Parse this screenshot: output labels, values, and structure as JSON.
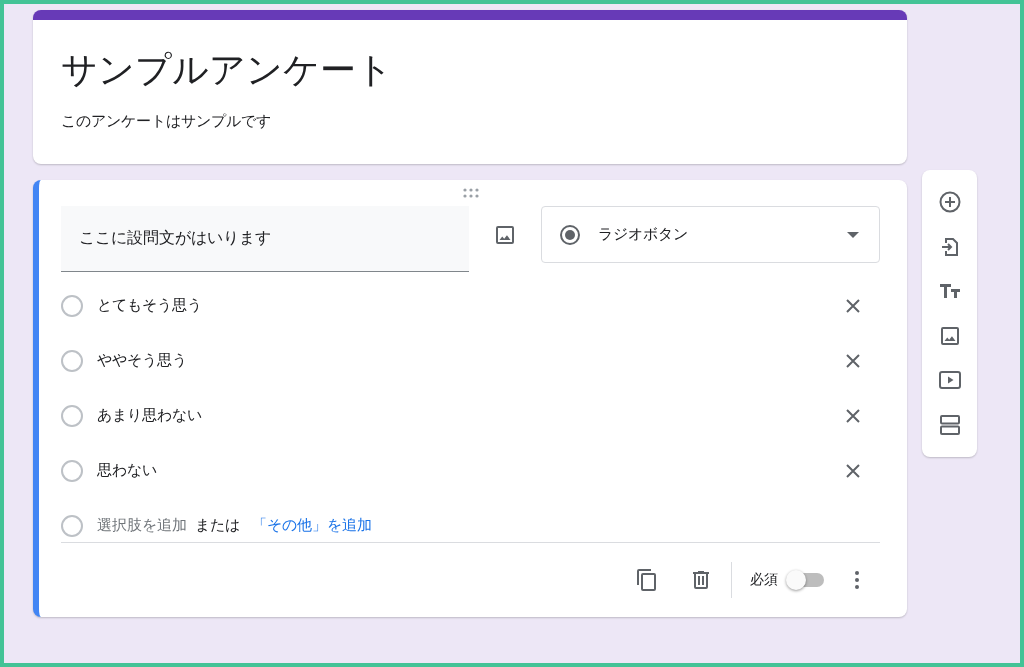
{
  "form": {
    "title": "サンプルアンケート",
    "description": "このアンケートはサンプルです"
  },
  "question": {
    "value": "ここに設問文がはいります",
    "type_label": "ラジオボタン",
    "options": [
      {
        "label": "とてもそう思う",
        "selected": false
      },
      {
        "label": "ややそう思う",
        "selected": false
      },
      {
        "label": "あまり思わない",
        "selected": false
      },
      {
        "label": "思わない",
        "selected": false
      }
    ],
    "add_option": {
      "selected": false,
      "label": "選択肢を追加",
      "separator": "または",
      "other_link": "「その他」を追加"
    },
    "required_label": "必須",
    "required": false
  }
}
